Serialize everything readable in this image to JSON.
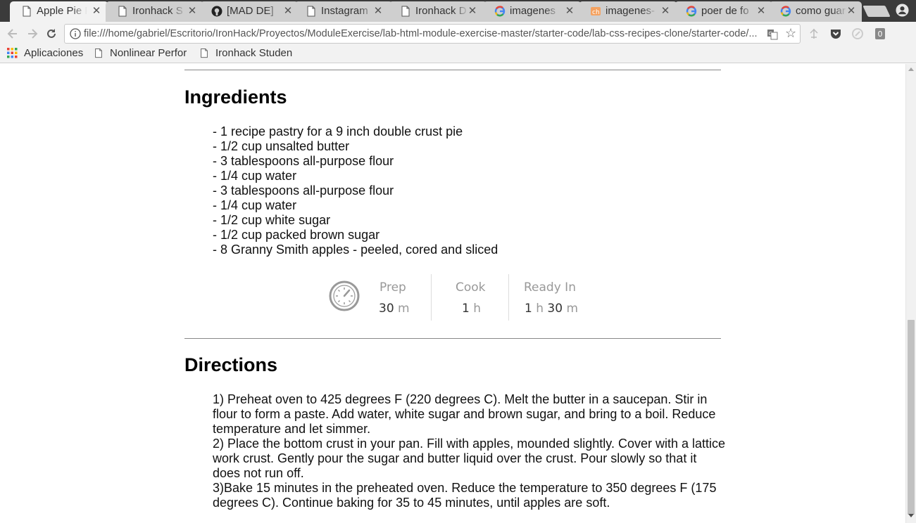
{
  "tabs": [
    {
      "title": "Apple Pie F",
      "icon": "document-icon",
      "active": true
    },
    {
      "title": "Ironhack S",
      "icon": "document-icon"
    },
    {
      "title": "[MAD DE] ",
      "icon": "github-icon"
    },
    {
      "title": "Instagram",
      "icon": "document-icon"
    },
    {
      "title": "Ironhack D",
      "icon": "document-icon"
    },
    {
      "title": "imagenes ",
      "icon": "google-icon"
    },
    {
      "title": "imagenes-",
      "icon": "ch-icon"
    },
    {
      "title": "poer de fo",
      "icon": "google-icon"
    },
    {
      "title": "como guar",
      "icon": "google-icon"
    }
  ],
  "address_bar": {
    "url": "file:///home/gabriel/Escritorio/IronHack/Proyectos/ModuleExercise/lab-html-module-exercise-master/starter-code/lab-css-recipes-clone/starter-code/..."
  },
  "bookmarks": [
    {
      "label": "Aplicaciones",
      "icon": "apps-grid-icon"
    },
    {
      "label": "Nonlinear Perfor",
      "icon": "document-icon"
    },
    {
      "label": "Ironhack Studen",
      "icon": "document-icon"
    }
  ],
  "page": {
    "ingredients_heading": "Ingredients",
    "ingredients": [
      "- 1 recipe pastry for a 9 inch double crust pie",
      "- 1/2 cup unsalted butter",
      "- 3 tablespoons all-purpose flour",
      "- 1/4 cup water",
      "- 3 tablespoons all-purpose flour",
      "- 1/4 cup water",
      "- 1/2 cup white sugar",
      "- 1/2 cup packed brown sugar",
      "- 8 Granny Smith apples - peeled, cored and sliced"
    ],
    "times": {
      "prep": {
        "label": "Prep",
        "value": "30",
        "unit": "m"
      },
      "cook": {
        "label": "Cook",
        "value": "1",
        "unit": "h"
      },
      "ready": {
        "label": "Ready In",
        "hours": "1",
        "hours_unit": "h",
        "minutes": "30",
        "minutes_unit": "m"
      }
    },
    "directions_heading": "Directions",
    "directions": [
      "1) Preheat oven to 425 degrees F (220 degrees C). Melt the butter in a saucepan. Stir in flour to form a paste. Add water, white sugar and brown sugar, and bring to a boil. Reduce temperature and let simmer.",
      "2) Place the bottom crust in your pan. Fill with apples, mounded slightly. Cover with a lattice work crust. Gently pour the sugar and butter liquid over the crust. Pour slowly so that it does not run off.",
      "3)Bake 15 minutes in the preheated oven. Reduce the temperature to 350 degrees F (175 degrees C). Continue baking for 35 to 45 minutes, until apples are soft."
    ]
  },
  "colors": {
    "tabstrip": "#3b3b3b",
    "toolbar": "#f2f2f2",
    "rule": "#888888",
    "muted_text": "#999999"
  }
}
